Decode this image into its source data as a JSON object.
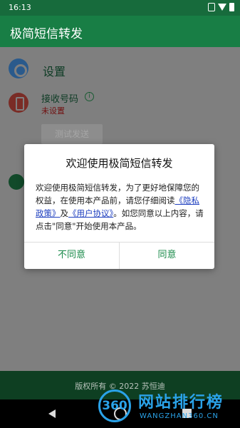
{
  "status_bar": {
    "time": "16:13"
  },
  "app_bar": {
    "title": "极简短信转发"
  },
  "settings": {
    "label": "设置"
  },
  "receive_number": {
    "label": "接收号码",
    "info_icon": "info-icon",
    "status": "未设置"
  },
  "test_button": {
    "label": "测试发送"
  },
  "footer": {
    "copyright": "版权所有 © 2022 苏恒迪"
  },
  "dialog": {
    "title": "欢迎使用极简短信转发",
    "body_part1": "欢迎使用极简短信转发，为了更好地保障您的权益，在使用本产品前，请您仔细阅读",
    "privacy_link": "《隐私政策》",
    "body_and": "及",
    "agreement_link": "《用户协议》",
    "body_part2": "。如您同意以上内容，请点击\"同意\"开始使用本产品。",
    "disagree_label": "不同意",
    "agree_label": "同意"
  },
  "watermark": {
    "logo_text": "360",
    "name": "网站排行榜",
    "url": "WANGZHAN360.CN"
  },
  "colors": {
    "app_green": "#187e45",
    "link_blue": "#1e3fbf",
    "button_green": "#1a8a4a"
  }
}
